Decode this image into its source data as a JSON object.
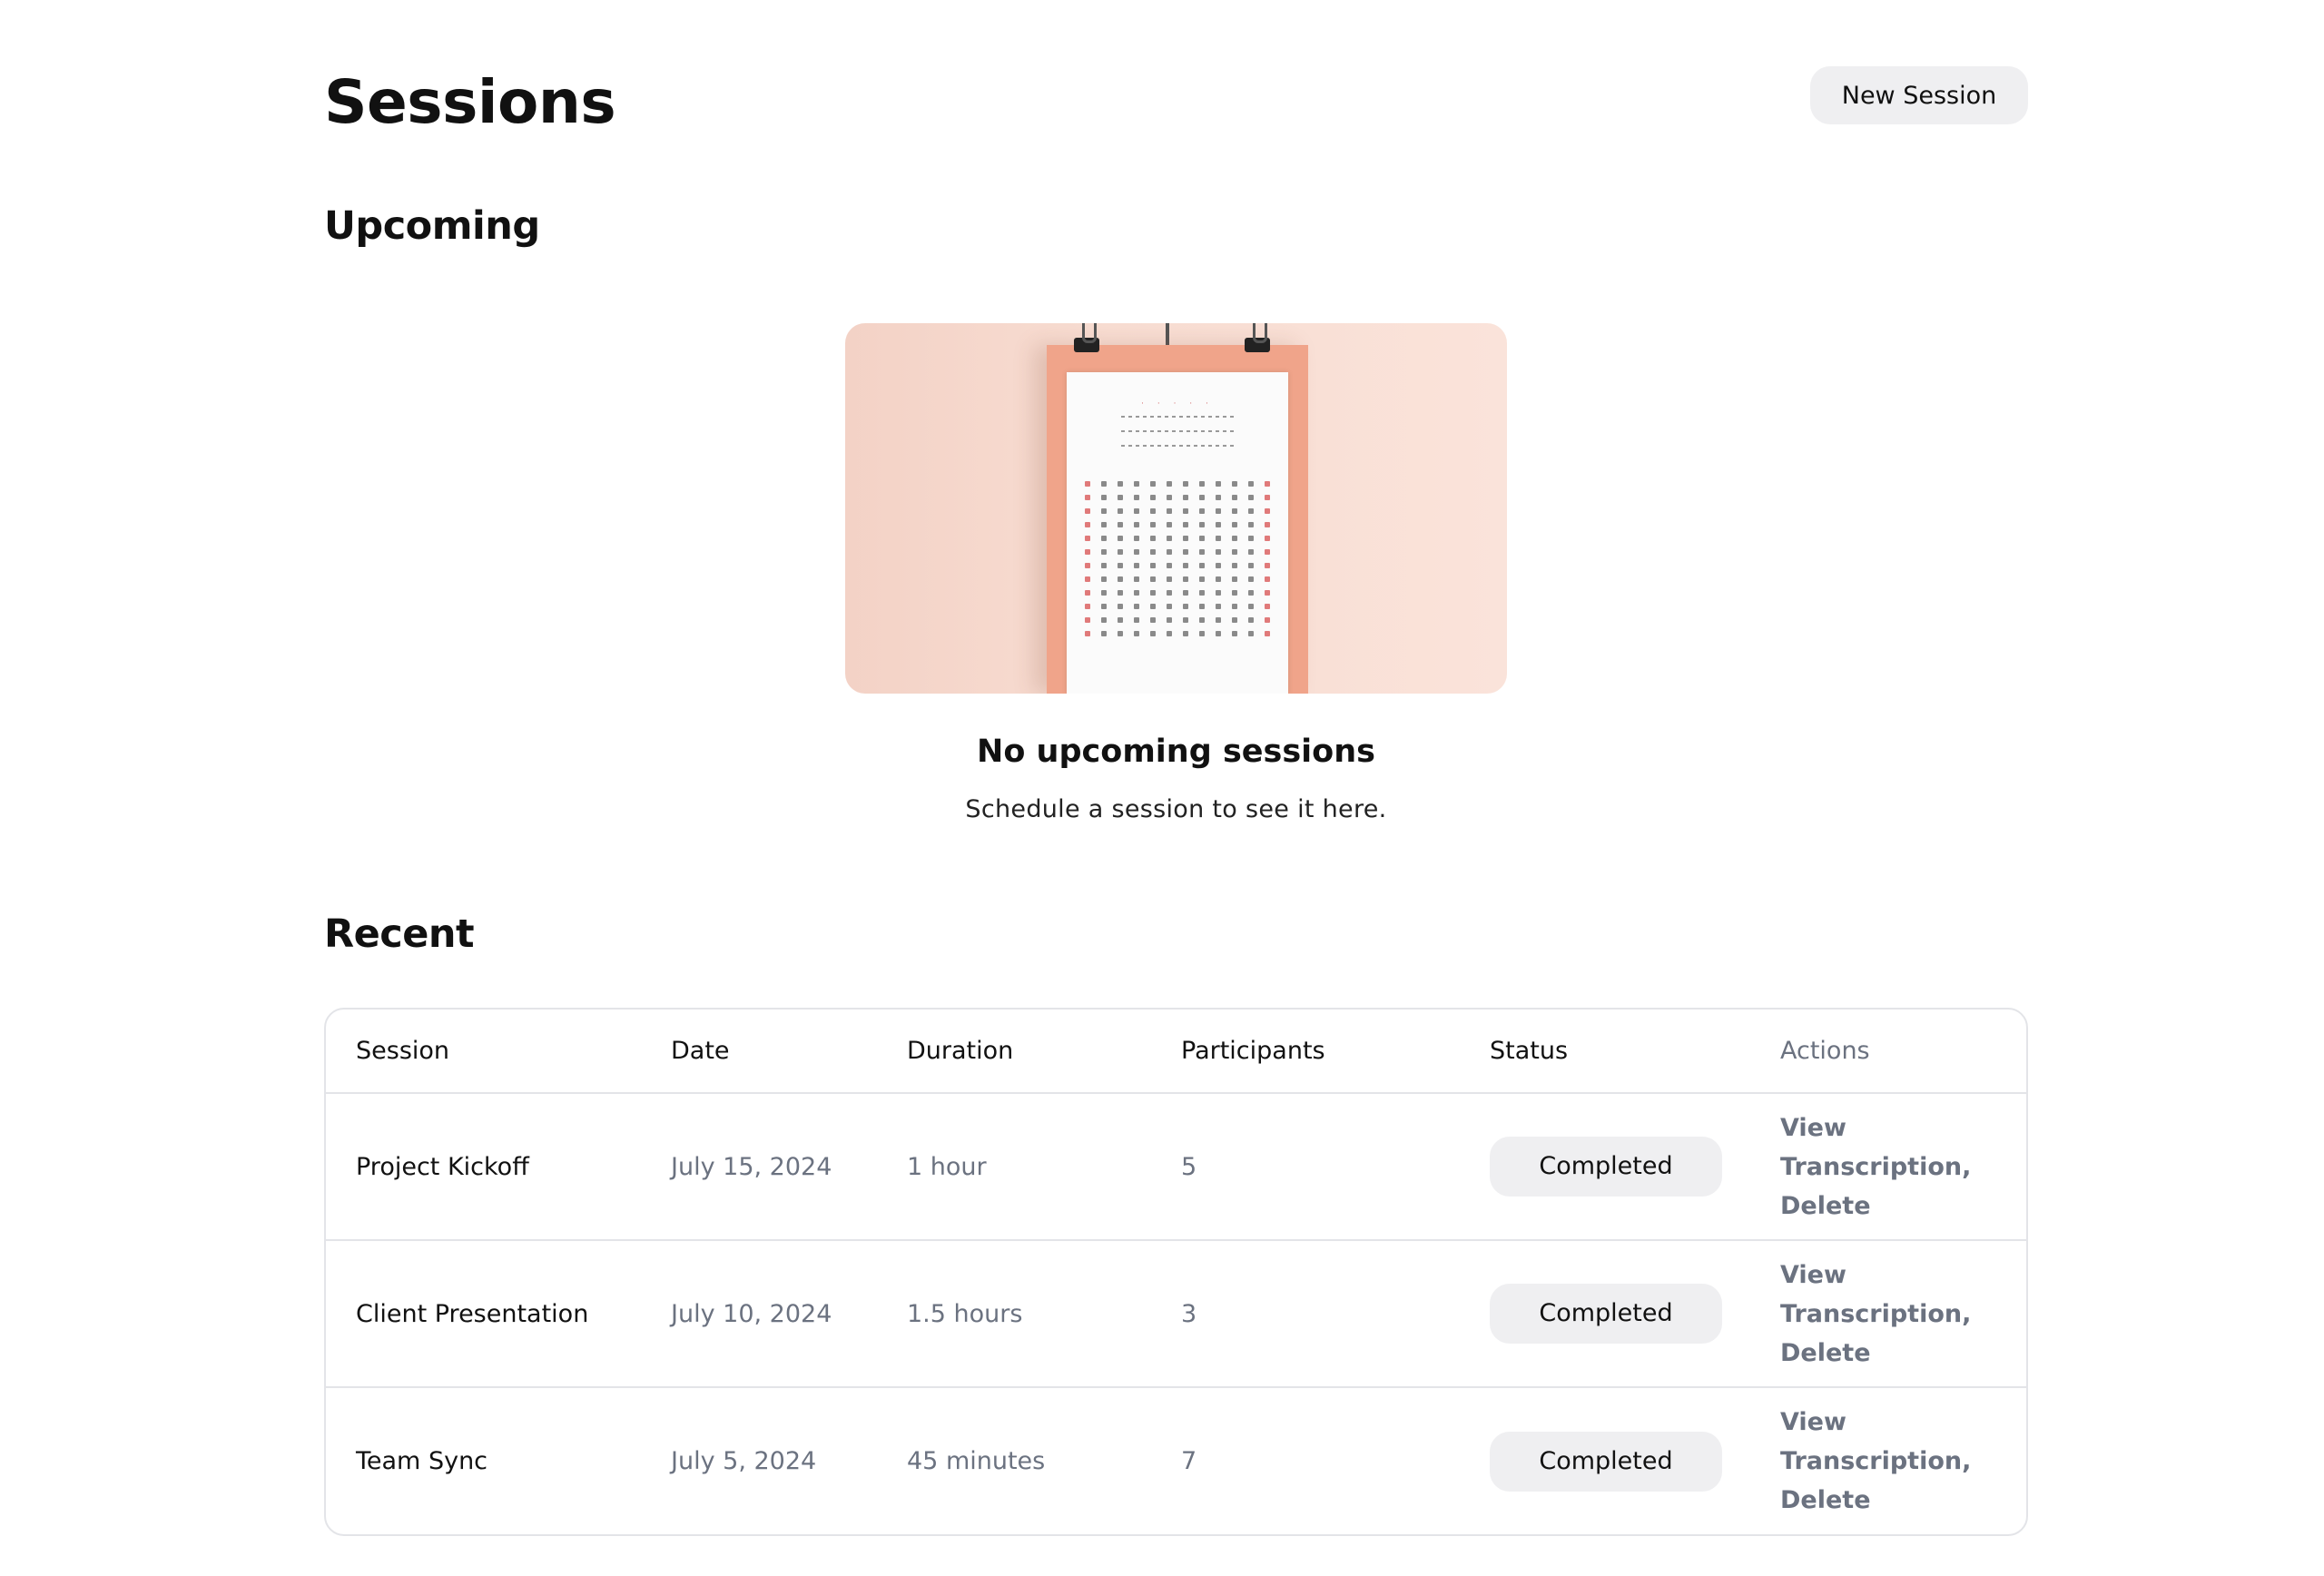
{
  "header": {
    "title": "Sessions",
    "new_session_label": "New Session"
  },
  "upcoming": {
    "title": "Upcoming",
    "empty_title": "No upcoming sessions",
    "empty_subtitle": "Schedule a session to see it here."
  },
  "recent": {
    "title": "Recent",
    "columns": [
      "Session",
      "Date",
      "Duration",
      "Participants",
      "Status",
      "Actions"
    ],
    "rows": [
      {
        "session": "Project Kickoff",
        "date": "July 15, 2024",
        "duration": "1 hour",
        "participants": "5",
        "status": "Completed",
        "actions": {
          "view": "View Transcription",
          "separator": ",",
          "delete": "Delete"
        }
      },
      {
        "session": "Client Presentation",
        "date": "July 10, 2024",
        "duration": "1.5 hours",
        "participants": "3",
        "status": "Completed",
        "actions": {
          "view": "View Transcription",
          "separator": ",",
          "delete": "Delete"
        }
      },
      {
        "session": "Team Sync",
        "date": "July 5, 2024",
        "duration": "45 minutes",
        "participants": "7",
        "status": "Completed",
        "actions": {
          "view": "View Transcription",
          "separator": ",",
          "delete": "Delete"
        }
      }
    ]
  },
  "illustration": {
    "name": "wall-calendar-illustration",
    "colors": {
      "background": "#f8ddd2",
      "board": "#f0a48a",
      "sheet": "#fbfbfb",
      "accent": "#e07a7a"
    }
  }
}
